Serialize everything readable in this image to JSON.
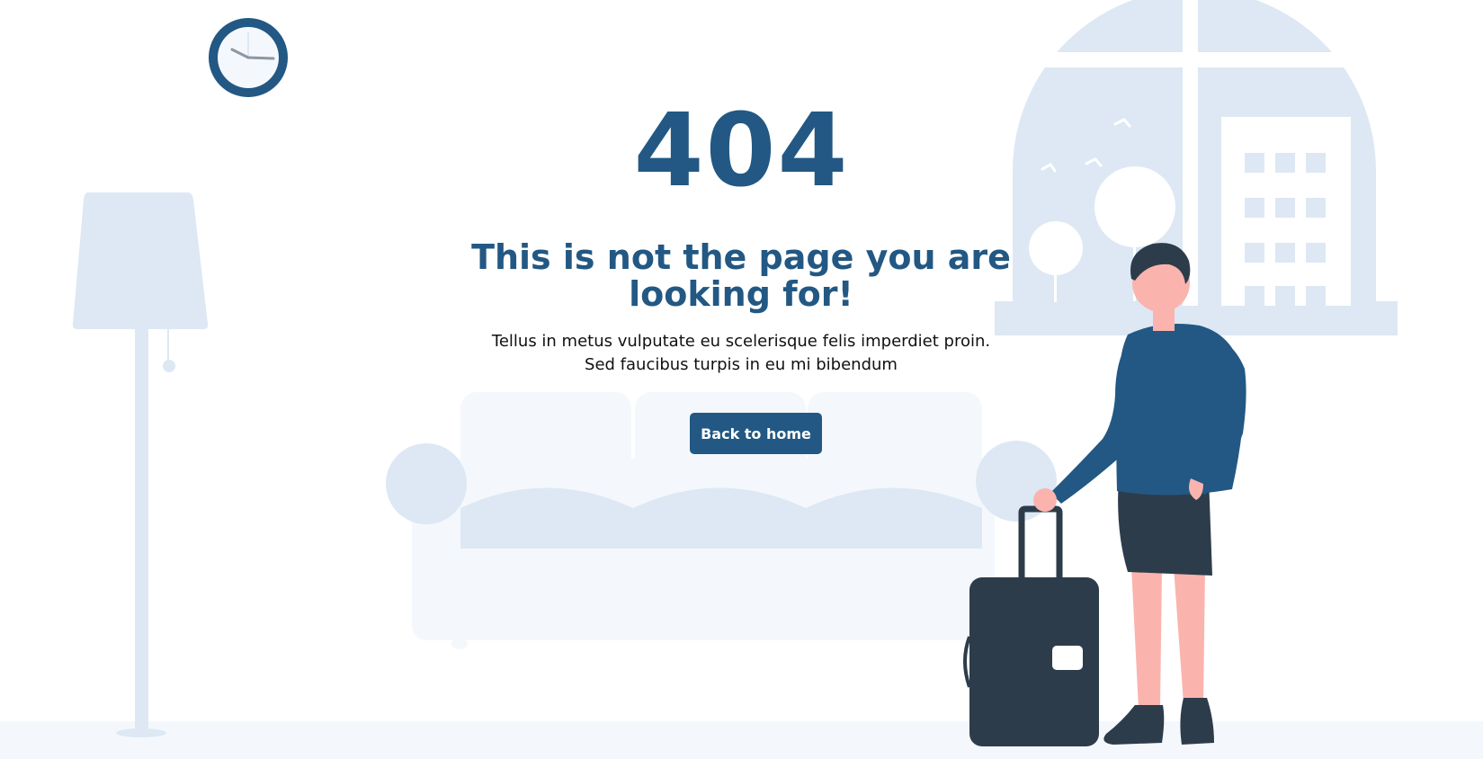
{
  "error": {
    "code": "404",
    "headline": "This is not the page you are looking for!",
    "description_line1": "Tellus in metus vulputate eu scelerisque felis imperdiet proin.",
    "description_line2": "Sed faucibus turpis in eu mi bibendum"
  },
  "actions": {
    "home_label": "Back to home"
  },
  "illustration": {
    "scene": [
      "wall-clock",
      "floor-lamp",
      "sofa",
      "window",
      "trees",
      "building",
      "birds",
      "person",
      "suitcase",
      "floor"
    ]
  },
  "colors": {
    "brand": "#225883",
    "light_blue": "#dde8f4",
    "pale_blue": "#f4f8fc",
    "dark": "#2d3c4a",
    "skin": "#fbb3ae",
    "text": "#111111",
    "background": "#ffffff"
  }
}
